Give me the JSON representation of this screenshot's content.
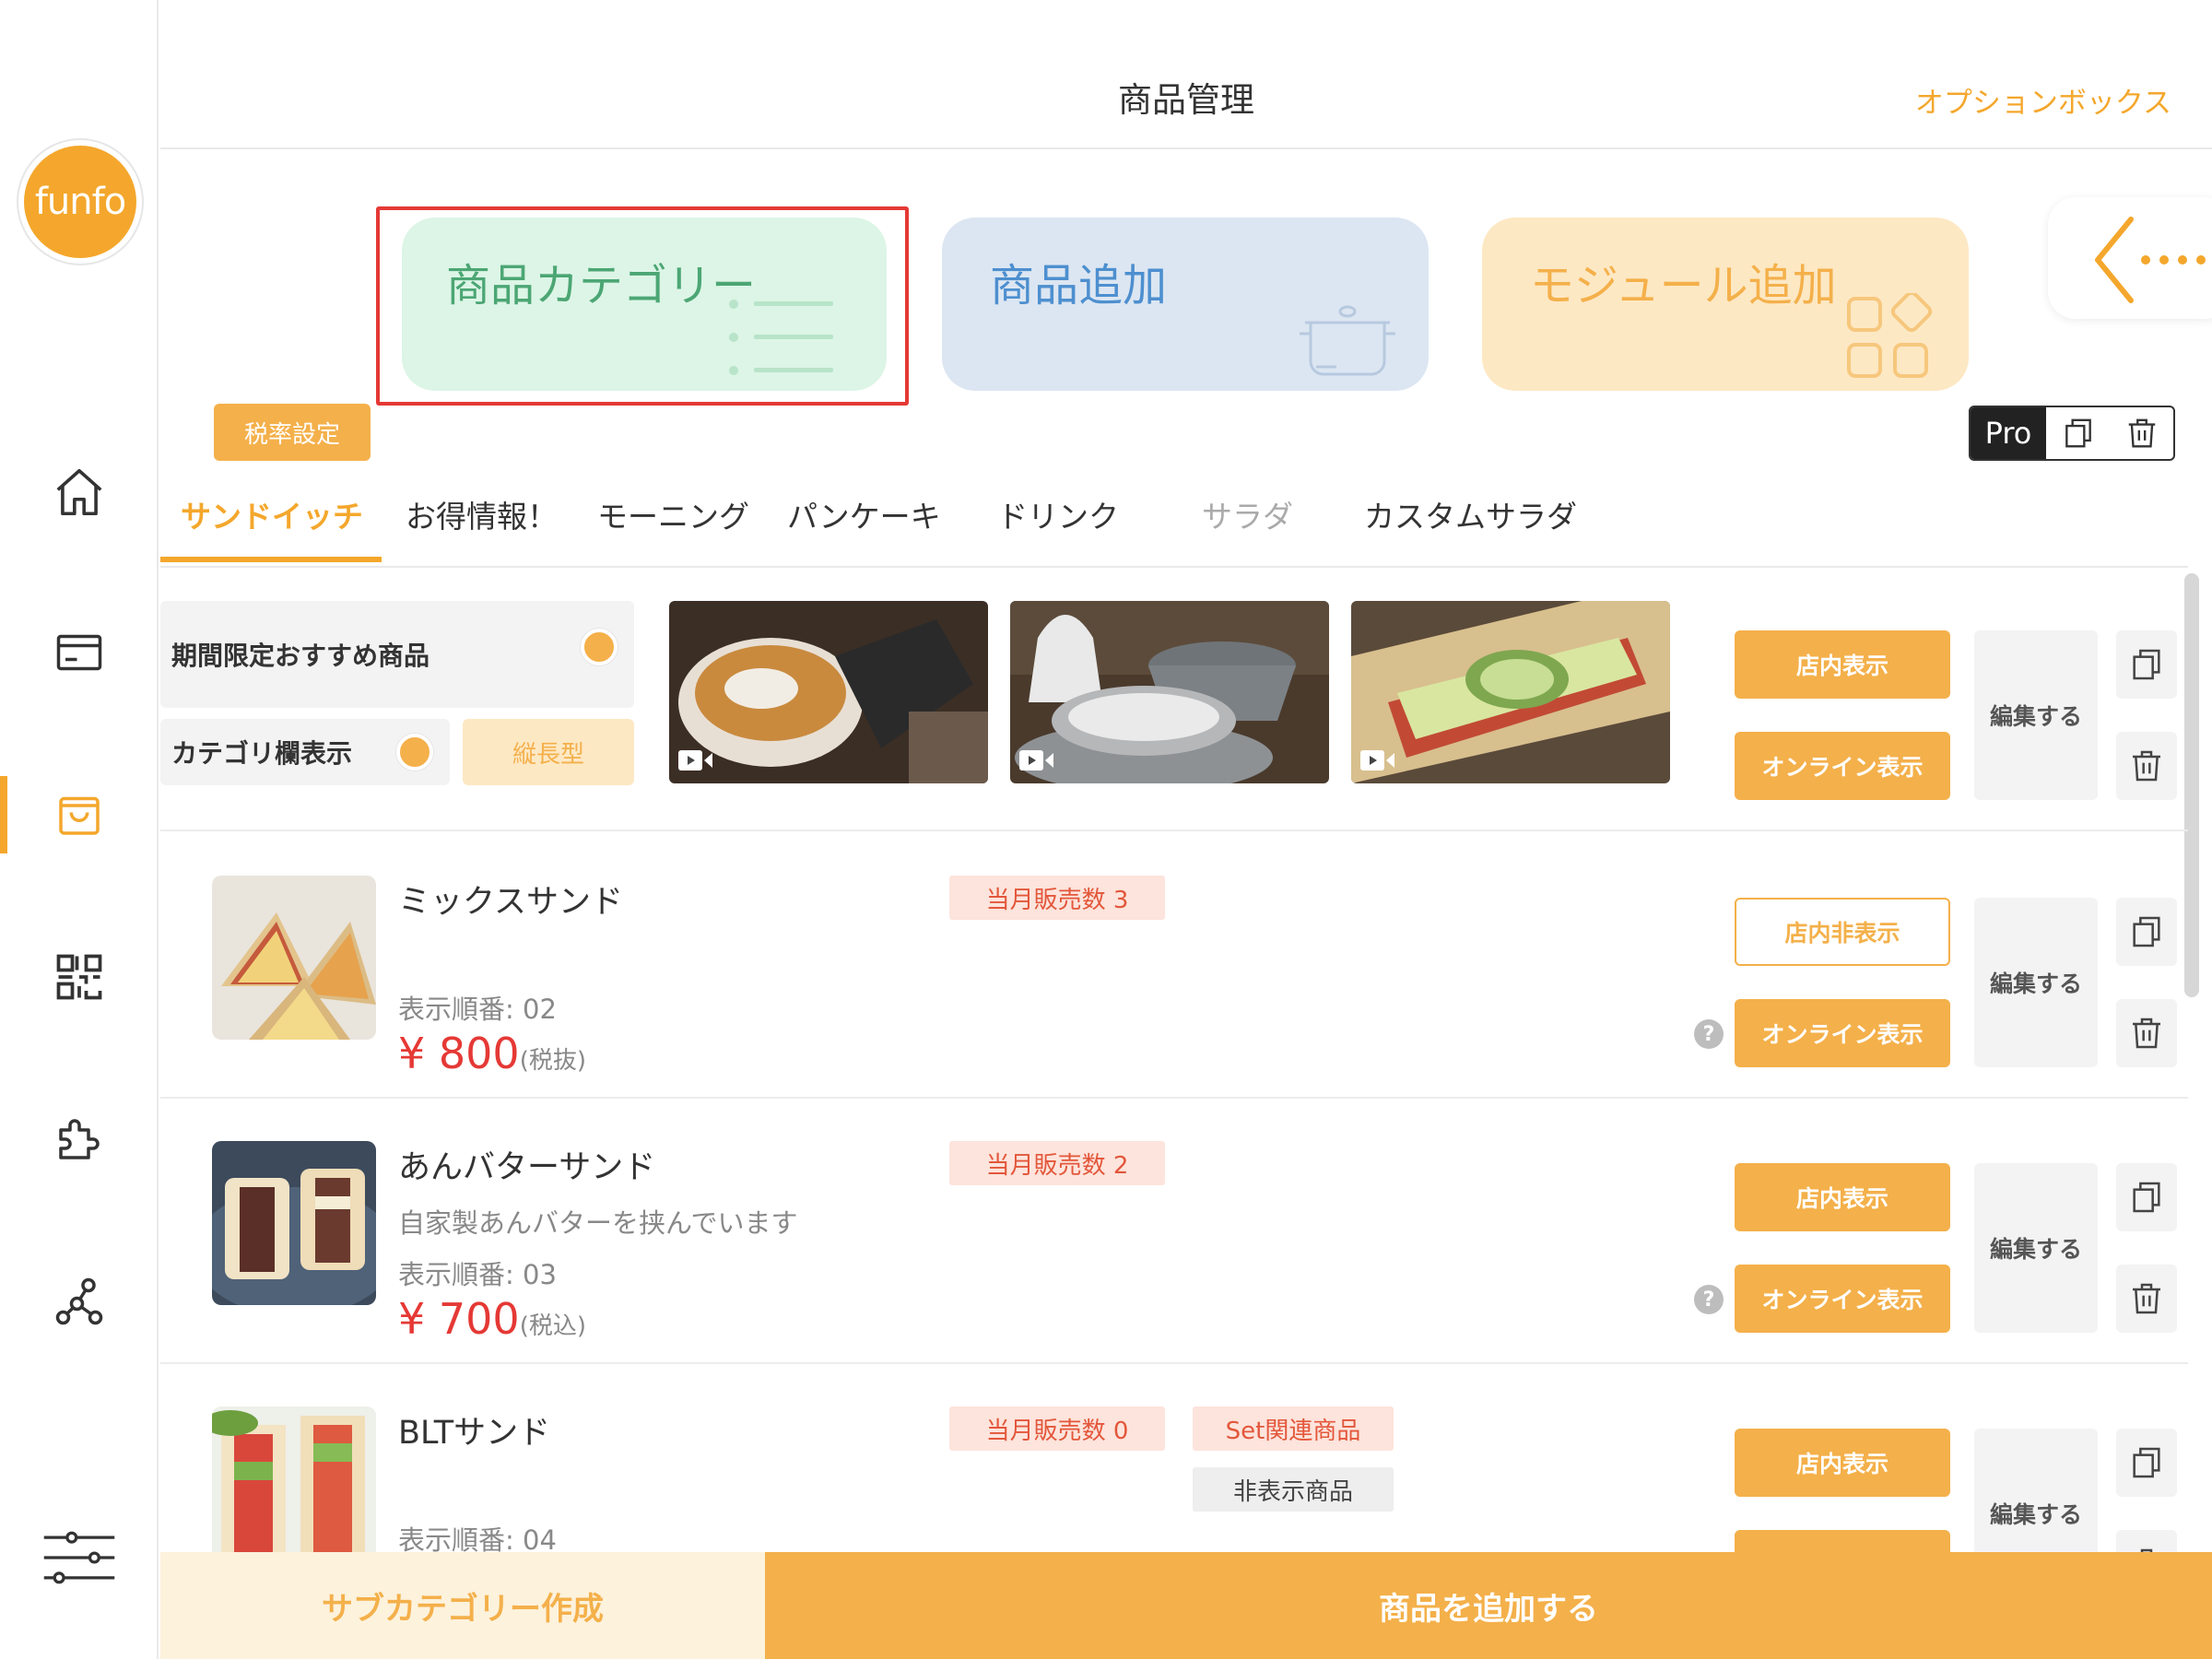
{
  "brand": {
    "logo_text": "funfo",
    "accent_color": "#f4a72c"
  },
  "sidebar": {
    "items": [
      {
        "icon": "home-icon"
      },
      {
        "icon": "card-icon"
      },
      {
        "icon": "shopping-bag-icon",
        "active": true
      },
      {
        "icon": "qr-code-icon"
      },
      {
        "icon": "puzzle-icon"
      },
      {
        "icon": "network-icon"
      },
      {
        "icon": "settings-sliders-icon"
      }
    ]
  },
  "header": {
    "title": "商品管理",
    "option_box": "オプションボックス"
  },
  "cards": {
    "category": "商品カテゴリー",
    "add_product": "商品追加",
    "add_module": "モジュール追加"
  },
  "toolbar": {
    "tax_setting": "税率設定",
    "pro_label": "Pro"
  },
  "tabs": [
    {
      "label": "サンドイッチ",
      "active": true
    },
    {
      "label": "お得情報！"
    },
    {
      "label": "モーニング"
    },
    {
      "label": "パンケーキ"
    },
    {
      "label": "ドリンク"
    },
    {
      "label": "サラダ",
      "muted": true
    },
    {
      "label": "カスタムサラダ"
    }
  ],
  "feature": {
    "limited_label": "期間限定おすすめ商品",
    "category_display_label": "カテゴリ欄表示",
    "layout_button": "縦長型",
    "store_display": "店内表示",
    "online_display": "オンライン表示",
    "edit": "編集する"
  },
  "products": [
    {
      "name": "ミックスサンド",
      "description": "",
      "order": "表示順番: 02",
      "price": "¥ 800",
      "tax_note": "(税抜)",
      "sales": "当月販売数 3",
      "store_btn": "店内非表示",
      "store_outline": true,
      "online_btn": "オンライン表示",
      "edit": "編集する"
    },
    {
      "name": "あんバターサンド",
      "description": "自家製あんバターを挟んでいます",
      "order": "表示順番: 03",
      "price": "¥ 700",
      "tax_note": "(税込)",
      "sales": "当月販売数 2",
      "store_btn": "店内表示",
      "online_btn": "オンライン表示",
      "edit": "編集する"
    },
    {
      "name": "BLTサンド",
      "description": "",
      "order": "表示順番: 04",
      "sales": "当月販売数 0",
      "set_badge": "Set関連商品",
      "hidden_badge": "非表示商品",
      "store_btn": "店内表示",
      "edit": "編集する"
    }
  ],
  "bottom": {
    "create_subcategory": "サブカテゴリー作成",
    "add_product": "商品を追加する"
  }
}
